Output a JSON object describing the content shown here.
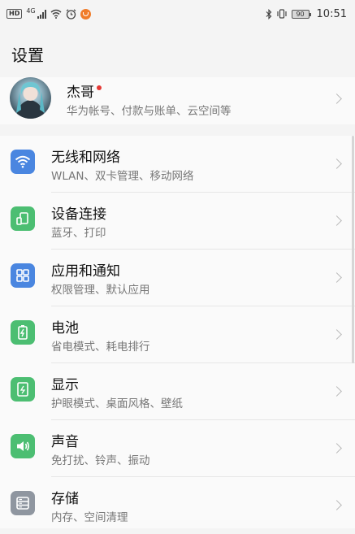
{
  "status_bar": {
    "left_badge": "HD",
    "network_type": "4G",
    "battery_level": "90",
    "time": "10:51",
    "icons": [
      "hd-icon",
      "signal-icon",
      "wifi-icon",
      "alarm-icon",
      "app-notification-icon",
      "bluetooth-icon",
      "vibrate-icon",
      "battery-icon"
    ]
  },
  "header": {
    "title": "设置"
  },
  "account": {
    "name": "杰哥",
    "subtitle": "华为帐号、付款与账单、云空间等",
    "has_notification_dot": true
  },
  "settings": [
    {
      "title": "无线和网络",
      "subtitle": "WLAN、双卡管理、移动网络",
      "icon": "wifi-icon",
      "color": "#4a86e0"
    },
    {
      "title": "设备连接",
      "subtitle": "蓝牙、打印",
      "icon": "device-connection-icon",
      "color": "#4cbe72"
    },
    {
      "title": "应用和通知",
      "subtitle": "权限管理、默认应用",
      "icon": "apps-grid-icon",
      "color": "#4a86e0"
    },
    {
      "title": "电池",
      "subtitle": "省电模式、耗电排行",
      "icon": "battery-icon",
      "color": "#4cbe72"
    },
    {
      "title": "显示",
      "subtitle": "护眼模式、桌面风格、壁纸",
      "icon": "display-icon",
      "color": "#4cbe72"
    },
    {
      "title": "声音",
      "subtitle": "免打扰、铃声、振动",
      "icon": "speaker-icon",
      "color": "#4cbe72"
    },
    {
      "title": "存储",
      "subtitle": "内存、空间清理",
      "icon": "storage-icon",
      "color": "#8f96a0"
    }
  ]
}
